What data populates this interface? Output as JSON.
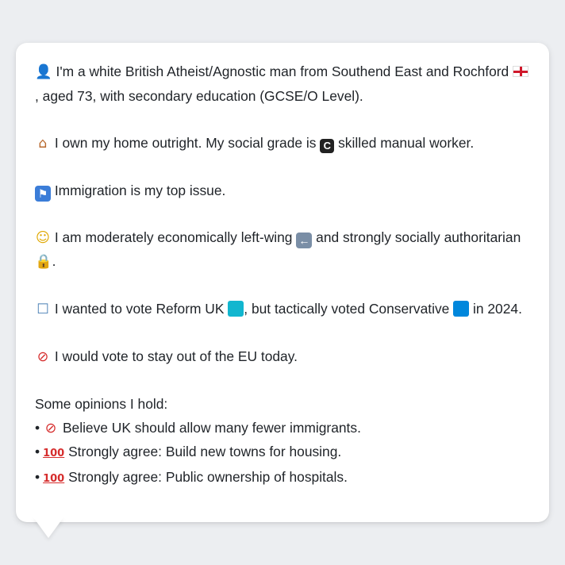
{
  "profile": {
    "intro": {
      "icon": "person-silhouette-icon",
      "text_a": "I'm a white British Atheist/Agnostic man from Southend East and Rochford ",
      "flag": "england-flag-icon",
      "text_b": ", aged 73, with secondary education (GCSE/O Level)."
    },
    "home": {
      "icon": "house-icon",
      "text_a": "I own my home outright. My social grade is ",
      "grade_badge": "C",
      "text_b": " skilled manual worker."
    },
    "issue": {
      "icon": "passport-control-icon",
      "text": "Immigration is my top issue."
    },
    "ideology": {
      "icon": "thinking-face-icon",
      "text_a": "I am moderately economically left-wing ",
      "left_icon": "left-arrow-icon",
      "text_b": " and strongly socially authoritarian ",
      "lock_icon": "lock-icon",
      "text_c": "."
    },
    "vote": {
      "icon": "ballot-box-icon",
      "text_a": "I wanted to vote Reform UK ",
      "reform_color": "#12B6CF",
      "text_b": ", but tactically voted Conservative ",
      "conservative_color": "#0087DC",
      "text_c": " in 2024."
    },
    "eu": {
      "icon": "no-entry-icon",
      "text": "I would vote to stay out of the EU today."
    },
    "opinions": {
      "heading": "Some opinions I hold:",
      "items": [
        {
          "icon": "no-entry-icon",
          "text": "Believe UK should allow many fewer immigrants."
        },
        {
          "icon": "hundred-points-icon",
          "text": "Strongly agree: Build new towns for housing."
        },
        {
          "icon": "hundred-points-icon",
          "text": "Strongly agree: Public ownership of hospitals."
        }
      ]
    }
  },
  "colors": {
    "background": "#eceef1",
    "card": "#ffffff",
    "text": "#1f2328"
  }
}
